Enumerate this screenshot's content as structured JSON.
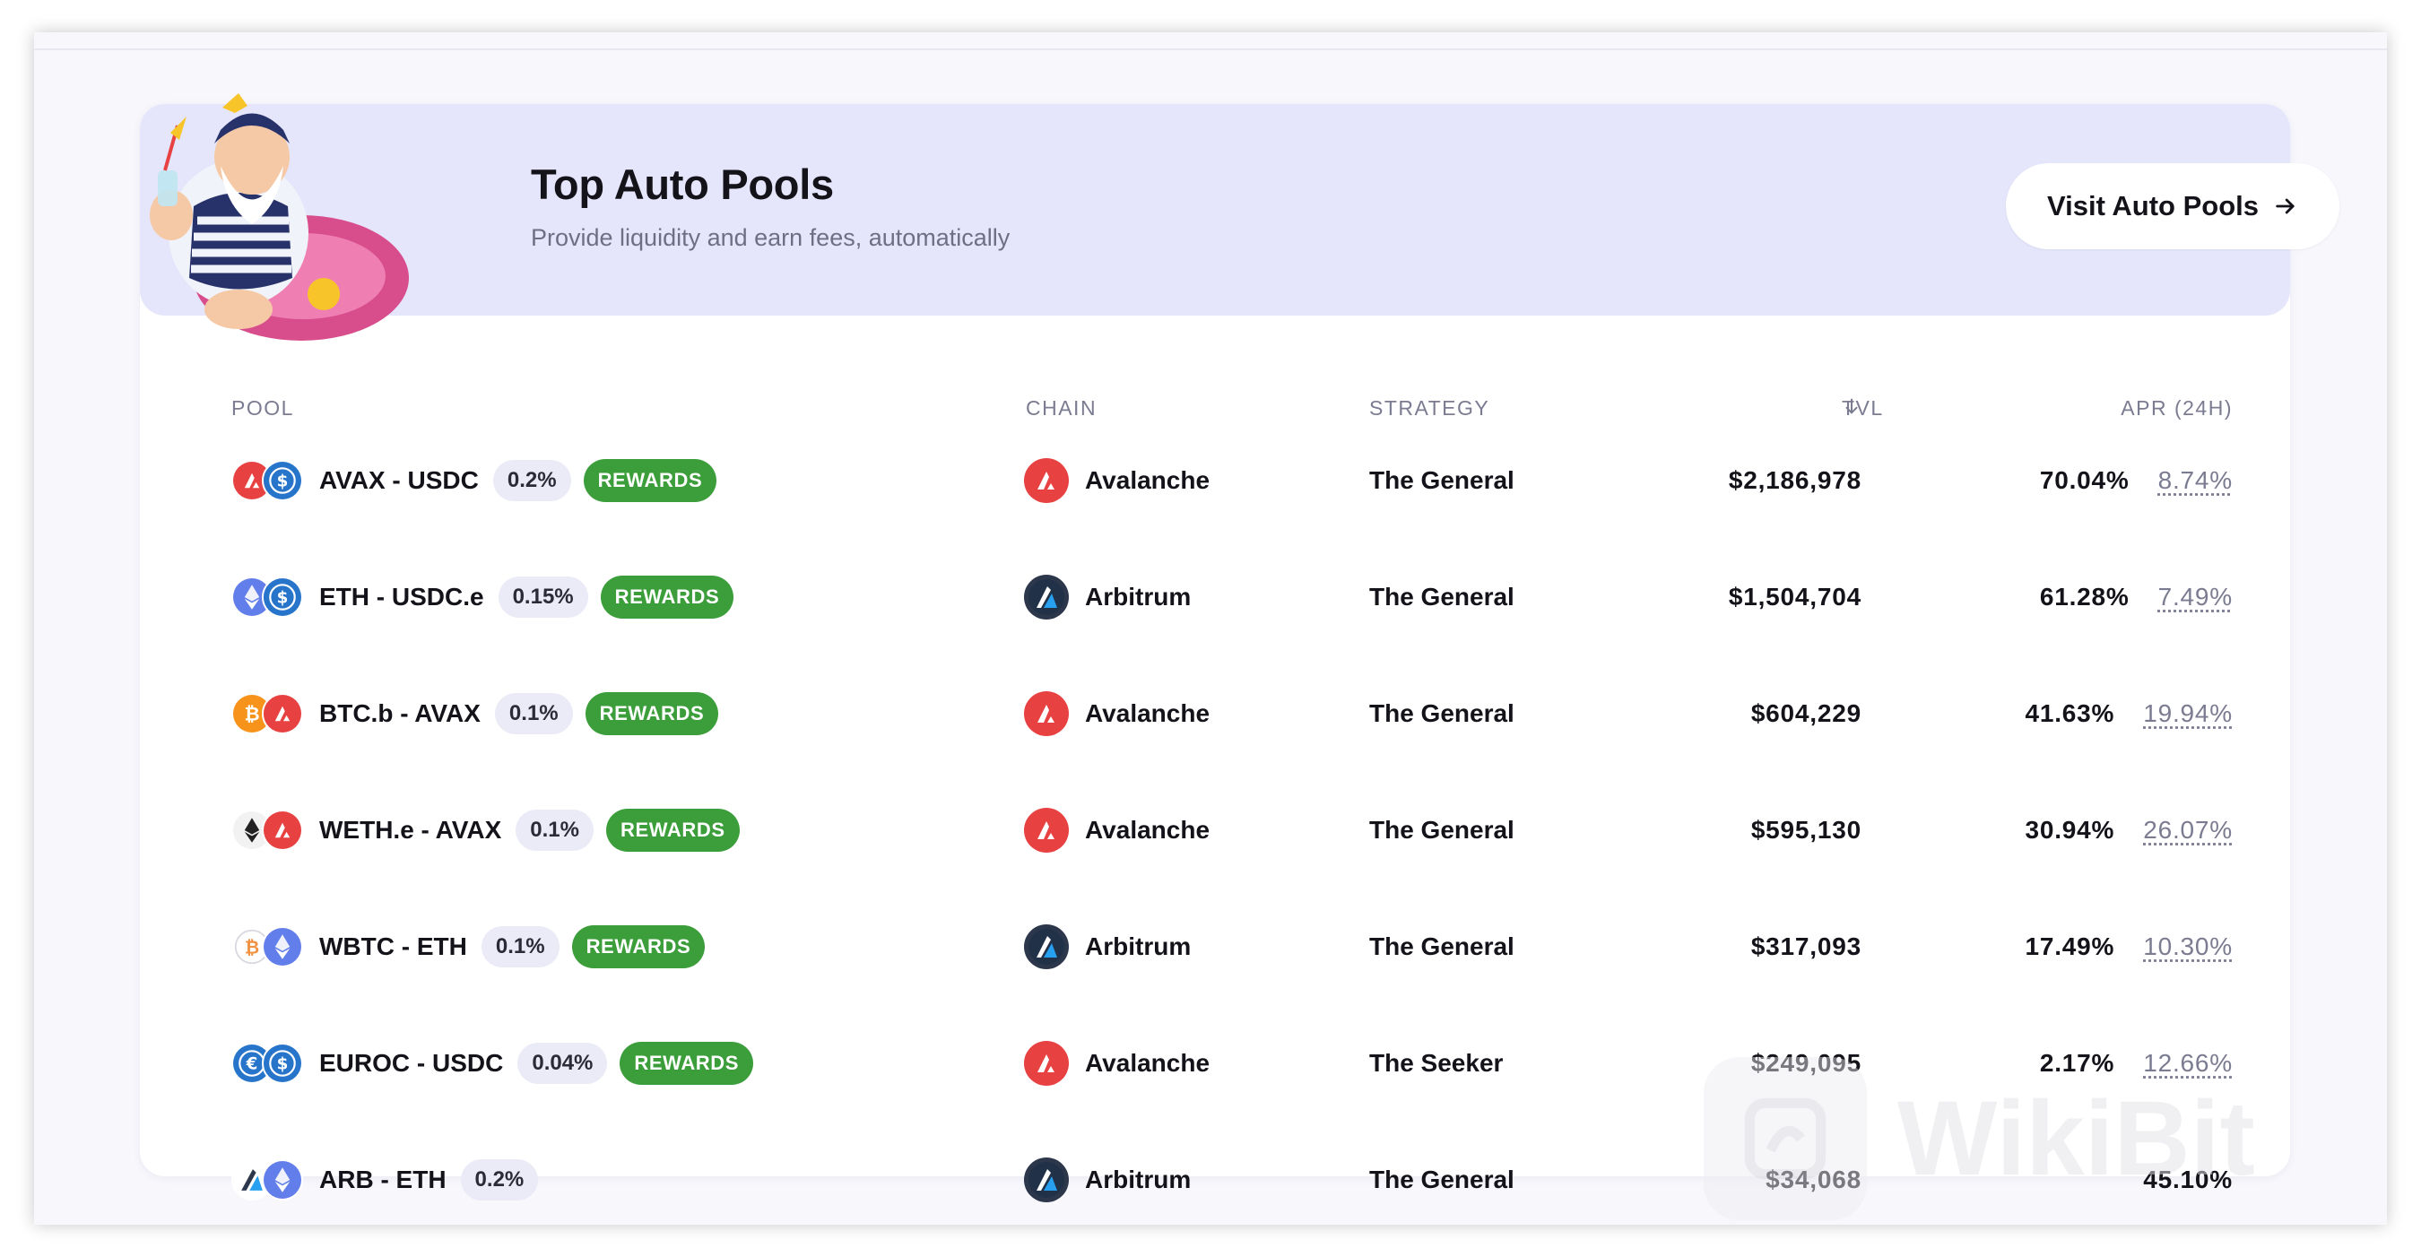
{
  "banner": {
    "title": "Top Auto Pools",
    "subtitle": "Provide liquidity and earn fees, automatically",
    "visit_button": "Visit Auto Pools"
  },
  "table": {
    "headers": {
      "pool": "POOL",
      "chain": "CHAIN",
      "strategy": "STRATEGY",
      "tvl": "TVL",
      "apr": "APR (24H)"
    },
    "sort": {
      "column": "tvl",
      "direction": "descending",
      "icon": "arrow-down-icon"
    },
    "rewards_label": "REWARDS",
    "rows": [
      {
        "pair": "AVAX - USDC",
        "tokens": [
          "avax",
          "usdc"
        ],
        "fee": "0.2%",
        "rewards": true,
        "chain": "Avalanche",
        "strategy": "The General",
        "tvl": "$2,186,978",
        "apr": "70.04%",
        "reward_apr": "8.74%"
      },
      {
        "pair": "ETH - USDC.e",
        "tokens": [
          "eth",
          "usdc"
        ],
        "fee": "0.15%",
        "rewards": true,
        "chain": "Arbitrum",
        "strategy": "The General",
        "tvl": "$1,504,704",
        "apr": "61.28%",
        "reward_apr": "7.49%"
      },
      {
        "pair": "BTC.b - AVAX",
        "tokens": [
          "btc",
          "avax"
        ],
        "fee": "0.1%",
        "rewards": true,
        "chain": "Avalanche",
        "strategy": "The General",
        "tvl": "$604,229",
        "apr": "41.63%",
        "reward_apr": "19.94%"
      },
      {
        "pair": "WETH.e - AVAX",
        "tokens": [
          "weth",
          "avax"
        ],
        "fee": "0.1%",
        "rewards": true,
        "chain": "Avalanche",
        "strategy": "The General",
        "tvl": "$595,130",
        "apr": "30.94%",
        "reward_apr": "26.07%"
      },
      {
        "pair": "WBTC - ETH",
        "tokens": [
          "wbtc",
          "eth"
        ],
        "fee": "0.1%",
        "rewards": true,
        "chain": "Arbitrum",
        "strategy": "The General",
        "tvl": "$317,093",
        "apr": "17.49%",
        "reward_apr": "10.30%"
      },
      {
        "pair": "EUROC - USDC",
        "tokens": [
          "euroc",
          "usdc"
        ],
        "fee": "0.04%",
        "rewards": true,
        "chain": "Avalanche",
        "strategy": "The Seeker",
        "tvl": "$249,095",
        "apr": "2.17%",
        "reward_apr": "12.66%"
      },
      {
        "pair": "ARB - ETH",
        "tokens": [
          "arb",
          "eth"
        ],
        "fee": "0.2%",
        "rewards": false,
        "chain": "Arbitrum",
        "strategy": "The General",
        "tvl": "$34,068",
        "apr": "45.10%",
        "reward_apr": ""
      }
    ]
  },
  "watermark": {
    "text": "WikiBit"
  },
  "colors": {
    "banner_bg": "#e5e6fb",
    "rewards_badge": "#3b9e3a",
    "fee_badge": "#ebebf7",
    "avalanche_red": "#e84142",
    "usdc_blue": "#2775ca",
    "eth_purple": "#627eea",
    "btc_orange": "#f7931a",
    "arbitrum_navy": "#2d374b"
  },
  "icons": {
    "mascot": "sailor-mascot-illustration",
    "visit_arrow": "arrow-right-icon",
    "avalanche": "avalanche-icon",
    "arbitrum": "arbitrum-icon"
  }
}
